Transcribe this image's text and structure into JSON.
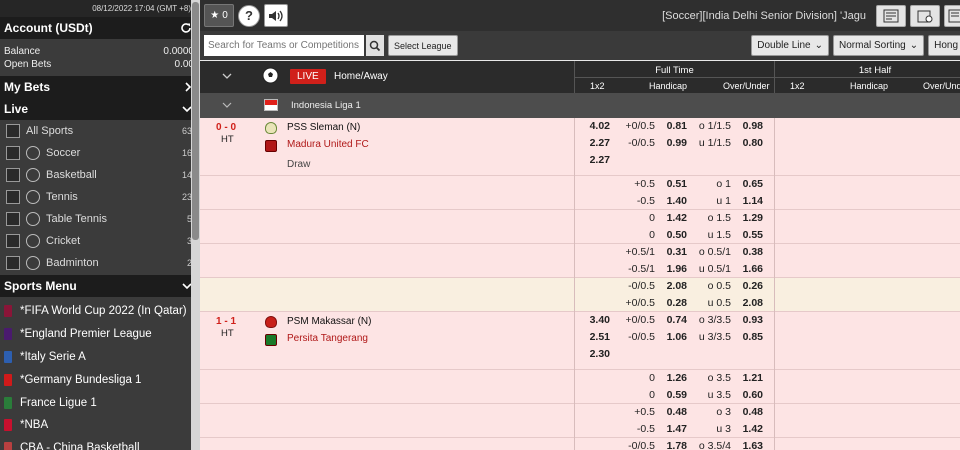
{
  "sidebar": {
    "datetime": "08/12/2022 17:04 (GMT +8)",
    "account_title": "Account (USDt)",
    "balance_label": "Balance",
    "balance_value": "0.0000",
    "open_bets_label": "Open Bets",
    "open_bets_value": "0.00",
    "my_bets": "My Bets",
    "live": "Live",
    "sports": [
      {
        "name": "All Sports",
        "count": "63",
        "icon": "all-sports-icon"
      },
      {
        "name": "Soccer",
        "count": "16",
        "icon": "soccer-icon"
      },
      {
        "name": "Basketball",
        "count": "14",
        "icon": "basketball-icon"
      },
      {
        "name": "Tennis",
        "count": "23",
        "icon": "tennis-icon"
      },
      {
        "name": "Table Tennis",
        "count": "5",
        "icon": "table-tennis-icon"
      },
      {
        "name": "Cricket",
        "count": "3",
        "icon": "cricket-icon"
      },
      {
        "name": "Badminton",
        "count": "2",
        "icon": "badminton-icon"
      }
    ],
    "sports_menu": "Sports Menu",
    "menu": [
      {
        "name": "*FIFA World Cup 2022 (In Qatar)",
        "color": "#8a1538"
      },
      {
        "name": "*England Premier League",
        "color": "#4a1a6e"
      },
      {
        "name": "*Italy Serie A",
        "color": "#2d5fb0"
      },
      {
        "name": "*Germany Bundesliga 1",
        "color": "#d11a1a"
      },
      {
        "name": "France Ligue 1",
        "color": "#2a7d3a"
      },
      {
        "name": "*NBA",
        "color": "#c8102e"
      },
      {
        "name": "CBA - China Basketball",
        "color": "#b84040"
      }
    ]
  },
  "topbar": {
    "fav_count": "0",
    "breadcrumb": "[Soccer][India Delhi Senior Division] 'Jagu"
  },
  "filter": {
    "search_placeholder": "Search for Teams or Competitions",
    "select_league": "Select League",
    "double_line": "Double Line",
    "normal_sorting": "Normal Sorting",
    "hong": "Hong"
  },
  "table": {
    "live_label": "LIVE",
    "home_away": "Home/Away",
    "full_time": "Full Time",
    "first_half": "1st Half",
    "col_1x2": "1x2",
    "col_handicap": "Handicap",
    "col_ou": "Over/Under",
    "league": "Indonesia Liga 1"
  },
  "matches": [
    {
      "score": "0 - 0",
      "status": "HT",
      "home": "PSS Sleman  (N)",
      "away": "Madura United FC",
      "draw": "Draw",
      "x12": [
        "4.02",
        "2.27",
        "2.27"
      ],
      "lines": [
        [
          [
            "+0/0.5",
            "0.81",
            "o 1/1.5",
            "0.98"
          ],
          [
            "-0/0.5",
            "0.99",
            "u 1/1.5",
            "0.80"
          ]
        ],
        [
          [
            "+0.5",
            "0.51",
            "o 1",
            "0.65"
          ],
          [
            "-0.5",
            "1.40",
            "u 1",
            "1.14"
          ]
        ],
        [
          [
            "0",
            "1.42",
            "o 1.5",
            "1.29"
          ],
          [
            "0",
            "0.50",
            "u 1.5",
            "0.55"
          ]
        ],
        [
          [
            "+0.5/1",
            "0.31",
            "o 0.5/1",
            "0.38"
          ],
          [
            "-0.5/1",
            "1.96",
            "u 0.5/1",
            "1.66"
          ]
        ],
        [
          [
            "-0/0.5",
            "2.08",
            "o 0.5",
            "0.26"
          ],
          [
            "+0/0.5",
            "0.28",
            "u 0.5",
            "2.08"
          ]
        ]
      ]
    },
    {
      "score": "1 - 1",
      "status": "HT",
      "home": "PSM Makassar  (N)",
      "away": "Persita Tangerang",
      "x12": [
        "3.40",
        "2.51",
        "2.30"
      ],
      "lines": [
        [
          [
            "+0/0.5",
            "0.74",
            "o 3/3.5",
            "0.93"
          ],
          [
            "-0/0.5",
            "1.06",
            "u 3/3.5",
            "0.85"
          ]
        ],
        [
          [
            "0",
            "1.26",
            "o 3.5",
            "1.21"
          ],
          [
            "0",
            "0.59",
            "u 3.5",
            "0.60"
          ]
        ],
        [
          [
            "+0.5",
            "0.48",
            "o 3",
            "0.48"
          ],
          [
            "-0.5",
            "1.47",
            "u 3",
            "1.42"
          ]
        ],
        [
          [
            "-0/0.5",
            "1.78",
            "o 3.5/4",
            "1.63"
          ]
        ]
      ]
    }
  ]
}
